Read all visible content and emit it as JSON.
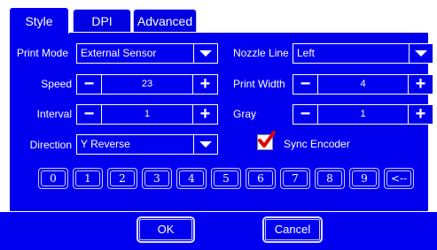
{
  "tabs": [
    {
      "label": "Style"
    },
    {
      "label": "DPI"
    },
    {
      "label": "Advanced"
    }
  ],
  "fields": {
    "print_mode": {
      "label": "Print Mode",
      "value": "External Sensor"
    },
    "nozzle_line": {
      "label": "Nozzle Line",
      "value": "Left"
    },
    "speed": {
      "label": "Speed",
      "value": "23"
    },
    "print_width": {
      "label": "Print Width",
      "value": "4"
    },
    "interval": {
      "label": "Interval",
      "value": "1"
    },
    "gray": {
      "label": "Gray",
      "value": "1"
    },
    "direction": {
      "label": "Direction",
      "value": "Y Reverse"
    },
    "sync_encoder": {
      "label": "Sync Encoder",
      "checked": true
    }
  },
  "stepper": {
    "minus": "−",
    "plus": "+"
  },
  "keypad": [
    "0",
    "1",
    "2",
    "3",
    "4",
    "5",
    "6",
    "7",
    "8",
    "9",
    "<--"
  ],
  "buttons": {
    "ok": "OK",
    "cancel": "Cancel"
  },
  "colors": {
    "background": "#0000ee",
    "foreground": "#ffffff",
    "checkmark": "#e00000"
  }
}
